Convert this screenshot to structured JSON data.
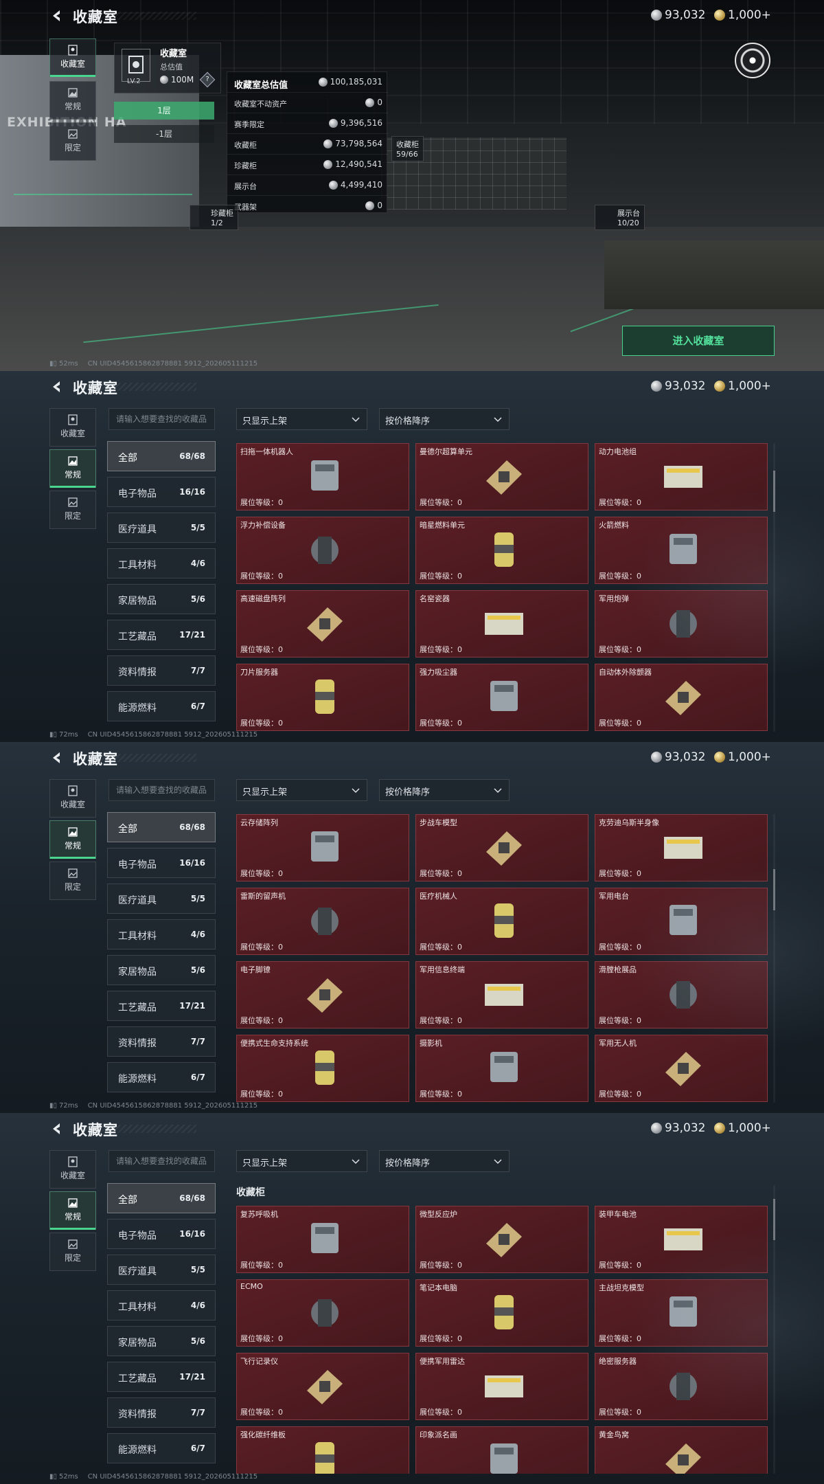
{
  "header": {
    "title": "收藏室",
    "currency_silver": "93,032",
    "currency_gold": "1,000+"
  },
  "side_tabs": [
    "收藏室",
    "常规",
    "限定"
  ],
  "hall": {
    "card_name": "收藏室",
    "card_sub": "总估值",
    "card_value": "100M",
    "card_level": "LV.2",
    "question": "?",
    "floors": [
      "1层",
      "-1层"
    ],
    "exhibition_sign": "EXHIBITION HA",
    "value_panel": [
      {
        "k": "收藏室总估值",
        "v": "100,185,031"
      },
      {
        "k": "收藏室不动资产",
        "v": "0"
      },
      {
        "k": "赛季限定",
        "v": "9,396,516"
      },
      {
        "k": "收藏柜",
        "v": "73,798,564"
      },
      {
        "k": "珍藏柜",
        "v": "12,490,541"
      },
      {
        "k": "展示台",
        "v": "4,499,410"
      },
      {
        "k": "武器架",
        "v": "0"
      }
    ],
    "tag_cabinet": {
      "name": "收藏柜",
      "value": "59/66"
    },
    "tag_treasure": {
      "name": "珍藏柜",
      "value": "1/2"
    },
    "tag_display": {
      "name": "展示台",
      "value": "10/20"
    },
    "enter_button": "进入收藏室"
  },
  "search_placeholder": "请输入想要查找的收藏品",
  "filter_show": "只显示上架",
  "filter_sort": "按价格降序",
  "categories": [
    {
      "name": "全部",
      "count": "68/68"
    },
    {
      "name": "电子物品",
      "count": "16/16"
    },
    {
      "name": "医疗道具",
      "count": "5/5"
    },
    {
      "name": "工具材料",
      "count": "4/6"
    },
    {
      "name": "家居物品",
      "count": "5/6"
    },
    {
      "name": "工艺藏品",
      "count": "17/21"
    },
    {
      "name": "资料情报",
      "count": "7/7"
    },
    {
      "name": "能源燃料",
      "count": "6/7"
    }
  ],
  "level_label": "展位等级：",
  "level_value": "0",
  "section_title": "收藏柜",
  "grid2": [
    {
      "name": "扫拖一体机器人",
      "icon": "robot-vacuum-icon"
    },
    {
      "name": "曼德尔超算单元",
      "icon": "supercomputer-chip-icon"
    },
    {
      "name": "动力电池组",
      "icon": "battery-pack-icon"
    },
    {
      "name": "浮力补偿设备",
      "icon": "buoyancy-device-icon"
    },
    {
      "name": "暗星燃料单元",
      "icon": "fuel-canister-icon"
    },
    {
      "name": "火箭燃料",
      "icon": "jerry-can-icon"
    },
    {
      "name": "高速磁盘阵列",
      "icon": "disk-array-icon"
    },
    {
      "name": "名窑瓷器",
      "icon": "porcelain-vase-icon"
    },
    {
      "name": "军用炮弹",
      "icon": "artillery-shell-icon"
    },
    {
      "name": "刀片服务器",
      "icon": "blade-server-icon"
    },
    {
      "name": "强力吸尘器",
      "icon": "vacuum-cleaner-icon"
    },
    {
      "name": "自动体外除颤器",
      "icon": "defibrillator-icon"
    }
  ],
  "grid3": [
    {
      "name": "云存储阵列",
      "icon": "storage-array-icon"
    },
    {
      "name": "步战车模型",
      "icon": "ifv-model-icon"
    },
    {
      "name": "克劳迪乌斯半身像",
      "icon": "bust-statue-icon"
    },
    {
      "name": "雷斯的留声机",
      "icon": "gramophone-icon"
    },
    {
      "name": "医疗机械人",
      "icon": "medical-robot-icon"
    },
    {
      "name": "军用电台",
      "icon": "military-radio-icon"
    },
    {
      "name": "电子脚镣",
      "icon": "ankle-monitor-icon"
    },
    {
      "name": "军用信息终端",
      "icon": "rugged-terminal-icon"
    },
    {
      "name": "滑膛枪展品",
      "icon": "musket-icon"
    },
    {
      "name": "便携式生命支持系统",
      "icon": "life-support-icon"
    },
    {
      "name": "摄影机",
      "icon": "camera-icon"
    },
    {
      "name": "军用无人机",
      "icon": "drone-icon"
    }
  ],
  "grid4": [
    {
      "name": "复苏呼吸机",
      "icon": "ventilator-icon"
    },
    {
      "name": "微型反应炉",
      "icon": "micro-reactor-icon"
    },
    {
      "name": "装甲车电池",
      "icon": "vehicle-battery-icon"
    },
    {
      "name": "ECMO",
      "icon": "ecmo-icon"
    },
    {
      "name": "笔记本电脑",
      "icon": "laptop-icon"
    },
    {
      "name": "主战坦克模型",
      "icon": "tank-model-icon"
    },
    {
      "name": "飞行记录仪",
      "icon": "flight-recorder-icon"
    },
    {
      "name": "便携军用雷达",
      "icon": "portable-radar-icon"
    },
    {
      "name": "绝密服务器",
      "icon": "server-blade-icon"
    },
    {
      "name": "强化碳纤维板",
      "icon": "carbon-plate-icon"
    },
    {
      "name": "印象派名画",
      "icon": "painting-frame-icon"
    },
    {
      "name": "黄金鸟窝",
      "icon": "golden-nest-icon"
    }
  ],
  "footer": {
    "ping1": "52ms",
    "ping2": "72ms",
    "ping3": "72ms",
    "ping4": "52ms",
    "uid": "CN UID4545615862878881 5912_202605111215"
  },
  "colors": {
    "accent": "#4ad68f",
    "item_bg": "#561d24",
    "item_border": "#b4505a"
  }
}
